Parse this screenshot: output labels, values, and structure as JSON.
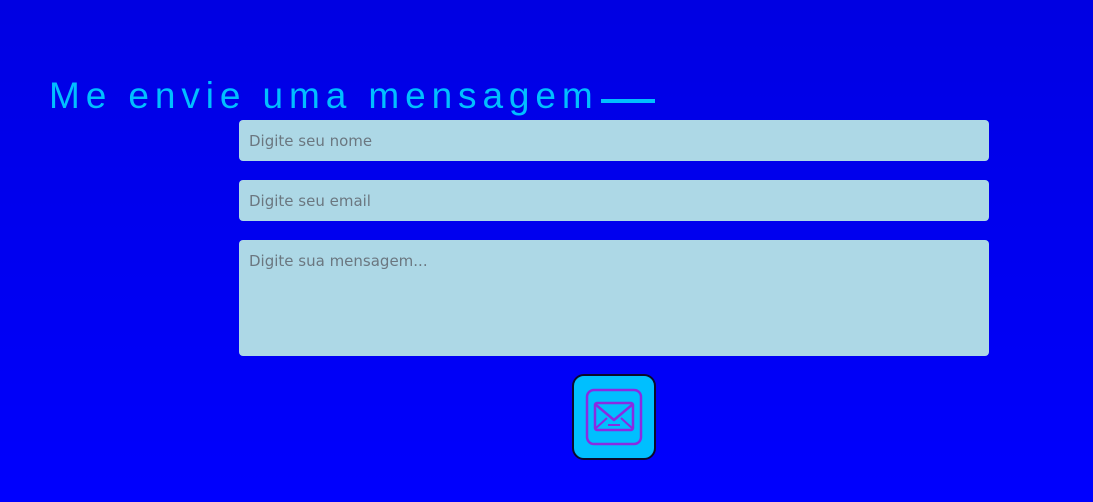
{
  "contact": {
    "heading": "Me envie uma mensagem",
    "name_placeholder": "Digite seu nome",
    "email_placeholder": "Digite seu email",
    "message_placeholder": "Digite sua mensagem...",
    "send_icon": "mail-icon"
  },
  "colors": {
    "background": "#0000f0",
    "accent": "#00bfff",
    "field_background": "#add8e6",
    "icon": "#8a2be2"
  }
}
